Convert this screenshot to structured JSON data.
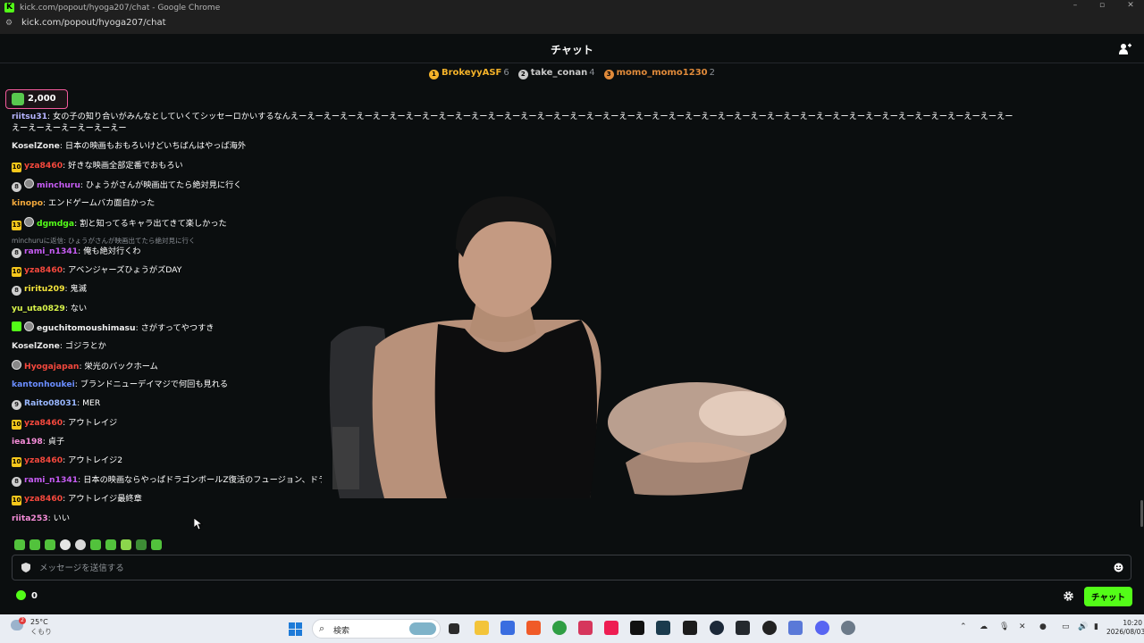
{
  "window": {
    "title": "kick.com/popout/hyoga207/chat - Google Chrome",
    "url": "kick.com/popout/hyoga207/chat"
  },
  "header": {
    "title": "チャット"
  },
  "leaderboard": [
    {
      "rank": "1",
      "name": "BrokeyyASF",
      "count": "6",
      "color": "#f5b32a"
    },
    {
      "rank": "2",
      "name": "take_conan",
      "count": "4",
      "color": "#c8c8c8"
    },
    {
      "rank": "3",
      "name": "momo_momo1230",
      "count": "2",
      "color": "#e08a3a"
    }
  ],
  "pinned": {
    "value": "2,000"
  },
  "messages": [
    {
      "user": "riitsu31",
      "text": ": 女の子の知り合いがみんなとしていくてシッセーロかいするなんえーえーえーえーえーえーえーえーえーえーえーえーえーえーえーえーえーえーえーえーえーえーえーえーえーえーえーえーえーえーえーえーえーえーえーえーえーえーえーえーえーえーえーえー",
      "color": "#b6b4ff"
    },
    {
      "user": "",
      "text": "えーえーえーえーえーえーえー",
      "color": "#ffffff"
    },
    {
      "user": "KoselZone",
      "text": ": 日本の映画もおもろいけどいちばんはやっぱ海外",
      "color": "#e9e9e9"
    },
    {
      "badge": "10",
      "user": "yza8460",
      "text": ": 好きな映画全部定番でおもろい",
      "color": "#f4483d"
    },
    {
      "badge": "8",
      "avatar": true,
      "user": "minchuru",
      "text": ": ひょうがさんが映画出てたら絶対見に行く",
      "color": "#c65cf3"
    },
    {
      "user": "kinopo",
      "text": ": エンドゲームバカ面白かった",
      "color": "#f3a93c"
    },
    {
      "badge": "13",
      "avatar": true,
      "user": "dgmdga",
      "text": ": 割と知ってるキャラ出てきて楽しかった",
      "color": "#53fc18"
    },
    {
      "reply": "minchuruに返信: ひょうがさんが映画出てたら絶対見に行く"
    },
    {
      "badge": "8",
      "user": "rami_n1341",
      "text": ": 俺も絶対行くわ",
      "color": "#c65cf3"
    },
    {
      "badge": "10",
      "user": "yza8460",
      "text": ": アベンジャーズひょうがズDAY",
      "color": "#f4483d"
    },
    {
      "badge": "8",
      "user": "riritu209",
      "text": ": 鬼滅",
      "color": "#f3e43c"
    },
    {
      "user": "yu_uta0829",
      "text": ": ない",
      "color": "#d8f34a"
    },
    {
      "badge": "g",
      "avatar": true,
      "user": "eguchitomoushimasu",
      "text": ": さがすってやつすき",
      "color": "#f0f0f0"
    },
    {
      "user": "KoselZone",
      "text": ": ゴジラとか",
      "color": "#e9e9e9"
    },
    {
      "avatar": true,
      "user": "Hyogajapan",
      "text": ": 栄光のバックホーム",
      "color": "#f4483d"
    },
    {
      "user": "kantonhoukei",
      "text": ": ブランドニューデイマジで何回も見れる",
      "color": "#6a8dff"
    },
    {
      "badge": "9",
      "user": "Raito08031",
      "text": ": MER",
      "color": "#9ab8ff"
    },
    {
      "badge": "10",
      "user": "yza8460",
      "text": ": アウトレイジ",
      "color": "#f4483d"
    },
    {
      "user": "iea198",
      "text": ": 貞子",
      "color": "#f58cd8"
    },
    {
      "badge": "10",
      "user": "yza8460",
      "text": ": アウトレイジ2",
      "color": "#f4483d"
    },
    {
      "badge": "8",
      "user": "rami_n1341",
      "text": ": 日本の映画ならやっぱドラゴンボールZ復活のフュージョン、ドラ",
      "color": "#c65cf3"
    },
    {
      "badge": "10",
      "user": "yza8460",
      "text": ": アウトレイジ最終章",
      "color": "#f4483d"
    },
    {
      "user": "riita253",
      "text": ": いい",
      "color": "#f58cd8"
    }
  ],
  "input": {
    "placeholder": "メッセージを送信する"
  },
  "footer": {
    "points": "0",
    "chat_button": "チャット"
  },
  "taskbar": {
    "temp": "25°C",
    "weather": "くもり",
    "search_label": "検索",
    "time": "10:20",
    "date": "2026/08/03"
  }
}
